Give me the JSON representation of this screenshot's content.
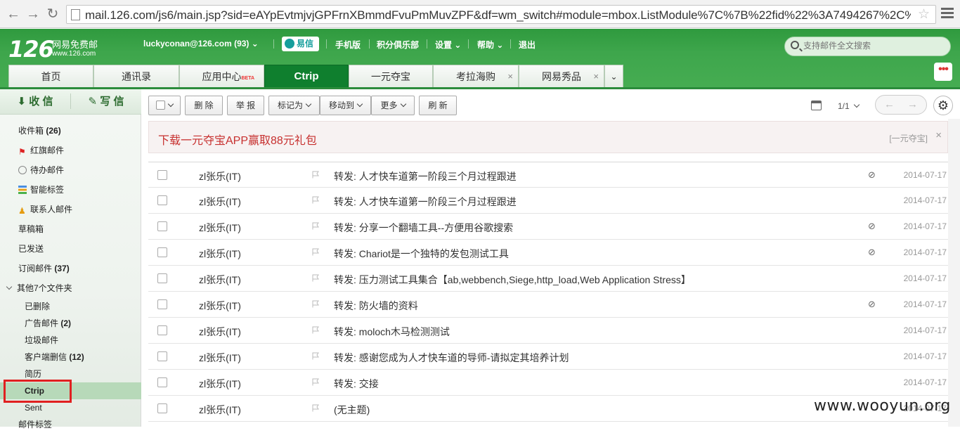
{
  "browser": {
    "url": "mail.126.com/js6/main.jsp?sid=eAYpEvtmjvjGPFrnXBmmdFvuPmMuvZPF&df=wm_switch#module=mbox.ListModule%7C%7B%22fid%22%3A7494267%2C%"
  },
  "header": {
    "logo_number": "126",
    "logo_title": "网易免费邮",
    "logo_domain": "www.126.com",
    "account": "luckyconan@126.com (93)",
    "yixin": "易信",
    "nav": [
      "手机版",
      "积分俱乐部",
      "设置",
      "帮助",
      "退出"
    ],
    "search_placeholder": "支持邮件全文搜索",
    "tabs": [
      {
        "label": "首页"
      },
      {
        "label": "通讯录"
      },
      {
        "label": "应用中心",
        "badge": "BETA"
      },
      {
        "label": "Ctrip"
      },
      {
        "label": "一元夺宝"
      },
      {
        "label": "考拉海购"
      },
      {
        "label": "网易秀品"
      }
    ],
    "tab_close": "×",
    "tab_more": "⌄",
    "app_menu": "•••"
  },
  "sidebar": {
    "receive": "收 信",
    "write": "写 信",
    "folders": [
      {
        "label": "收件箱",
        "count": "(26)"
      },
      {
        "label": "红旗邮件",
        "icon": "red-flag-icon"
      },
      {
        "label": "待办邮件",
        "icon": "clock-icon"
      },
      {
        "label": "智能标签",
        "icon": "tag-stack-icon"
      },
      {
        "label": "联系人邮件",
        "icon": "contact-icon"
      },
      {
        "label": "草稿箱"
      },
      {
        "label": "已发送"
      },
      {
        "label": "订阅邮件",
        "count": "(37)"
      },
      {
        "label": "其他7个文件夹",
        "icon": "chevron-down-icon"
      },
      {
        "label": "已删除"
      },
      {
        "label": "广告邮件",
        "count": "(2)"
      },
      {
        "label": "垃圾邮件"
      },
      {
        "label": "客户端删信",
        "count": "(12)"
      },
      {
        "label": "简历"
      },
      {
        "label": "Ctrip"
      },
      {
        "label": "Sent"
      },
      {
        "label": "邮件标签"
      }
    ]
  },
  "toolbar": {
    "delete": "删 除",
    "report": "举 报",
    "mark_as": "标记为",
    "move_to": "移动到",
    "more": "更多",
    "refresh": "刷 新",
    "page": "1/1",
    "prev": "←",
    "next": "→",
    "settings": "⚙"
  },
  "ad": {
    "text": "下载一元夺宝APP赢取88元礼包",
    "source": "[一元夺宝]",
    "close": "×"
  },
  "messages": [
    {
      "from": "zl张乐(IT)",
      "subject": "转发: 人才快车道第一阶段三个月过程跟进",
      "attachment": true,
      "date": "2014-07-17"
    },
    {
      "from": "zl张乐(IT)",
      "subject": "转发: 人才快车道第一阶段三个月过程跟进",
      "attachment": false,
      "date": "2014-07-17"
    },
    {
      "from": "zl张乐(IT)",
      "subject": "转发: 分享一个翻墙工具--方便用谷歌搜索",
      "attachment": true,
      "date": "2014-07-17"
    },
    {
      "from": "zl张乐(IT)",
      "subject": "转发: Chariot是一个独特的发包测试工具",
      "attachment": true,
      "date": "2014-07-17"
    },
    {
      "from": "zl张乐(IT)",
      "subject": "转发: 压力测试工具集合【ab,webbench,Siege,http_load,Web Application Stress】",
      "attachment": false,
      "date": "2014-07-17"
    },
    {
      "from": "zl张乐(IT)",
      "subject": "转发: 防火墙的资料",
      "attachment": true,
      "date": "2014-07-17"
    },
    {
      "from": "zl张乐(IT)",
      "subject": "转发: moloch木马检测测试",
      "attachment": false,
      "date": "2014-07-17"
    },
    {
      "from": "zl张乐(IT)",
      "subject": "转发: 感谢您成为人才快车道的导师-请拟定其培养计划",
      "attachment": false,
      "date": "2014-07-17"
    },
    {
      "from": "zl张乐(IT)",
      "subject": "转发: 交接",
      "attachment": false,
      "date": "2014-07-17"
    },
    {
      "from": "zl张乐(IT)",
      "subject": "(无主题)",
      "attachment": false,
      "date": "2014-07-17"
    }
  ],
  "attachment_glyph": "⊘",
  "watermark": "www.wooyun.org",
  "colors": {
    "brand_green": "#3ea64c",
    "active_tab": "#0f7f2e",
    "ad_text": "#c7302f",
    "highlight_box": "#e02020"
  }
}
